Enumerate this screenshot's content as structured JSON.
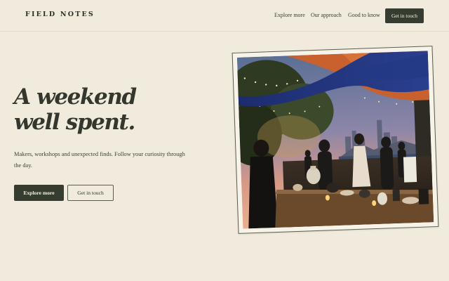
{
  "header": {
    "brand": "FIELD NOTES",
    "nav": [
      {
        "label": "Explore more"
      },
      {
        "label": "Our approach"
      },
      {
        "label": "Good to know"
      }
    ],
    "cta_label": "Get in touch"
  },
  "hero": {
    "title_line1": "A weekend",
    "title_line2": "well spent.",
    "body": "Makers, workshops and unexpected finds. Follow your curiosity through the day.",
    "primary_label": "Explore more",
    "secondary_label": "Get in touch"
  },
  "colors": {
    "background": "#f0ebdc",
    "accent_dark": "#363d30",
    "text": "#2c2f26"
  }
}
